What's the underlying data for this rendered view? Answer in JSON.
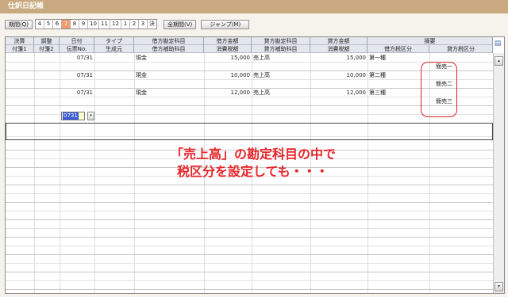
{
  "window": {
    "title": "仕訳日記帳"
  },
  "toolbar": {
    "period_button": "期間(Q)",
    "months": [
      "4",
      "5",
      "6",
      "7",
      "8",
      "9",
      "10",
      "11",
      "12",
      "1",
      "2",
      "3",
      "決"
    ],
    "active_month": "7",
    "all_period_button": "全期間(V)",
    "jump_button": "ジャンプ(M)"
  },
  "table": {
    "headers_top": [
      "決算",
      "調整",
      "日付",
      "タイプ",
      "借方勘定科目",
      "借方金額",
      "貸方勘定科目",
      "貸方金額",
      "摘要"
    ],
    "headers_bottom": [
      "付箋1",
      "付箋2",
      "伝票No.",
      "生成元",
      "借方補助科目",
      "消費税額",
      "貸方補助科目",
      "消費税額",
      "借方税区分",
      "貸方税区分"
    ],
    "rows": [
      {
        "date": "07/31",
        "debit_account": "現金",
        "debit_amount": "15,000",
        "credit_account": "売上高",
        "credit_amount": "15,000",
        "debit_tax_class": "第一種",
        "credit_tax_class": "簡売一"
      },
      {
        "date": "07/31",
        "debit_account": "現金",
        "debit_amount": "10,000",
        "credit_account": "売上高",
        "credit_amount": "10,000",
        "debit_tax_class": "第二種",
        "credit_tax_class": "簡売二"
      },
      {
        "date": "07/31",
        "debit_account": "現金",
        "debit_amount": "12,000",
        "credit_account": "売上高",
        "credit_amount": "12,000",
        "debit_tax_class": "第三種",
        "credit_tax_class": "簡売三"
      }
    ],
    "input_row": {
      "date_value": "0731"
    }
  },
  "annotation": {
    "line1": "「売上高」の勘定科目の中で",
    "line2": "税区分を設定しても・・・"
  },
  "colors": {
    "title_bar": "#c9aa80",
    "active_month": "#f19a6c",
    "highlight": "#d8232a"
  }
}
